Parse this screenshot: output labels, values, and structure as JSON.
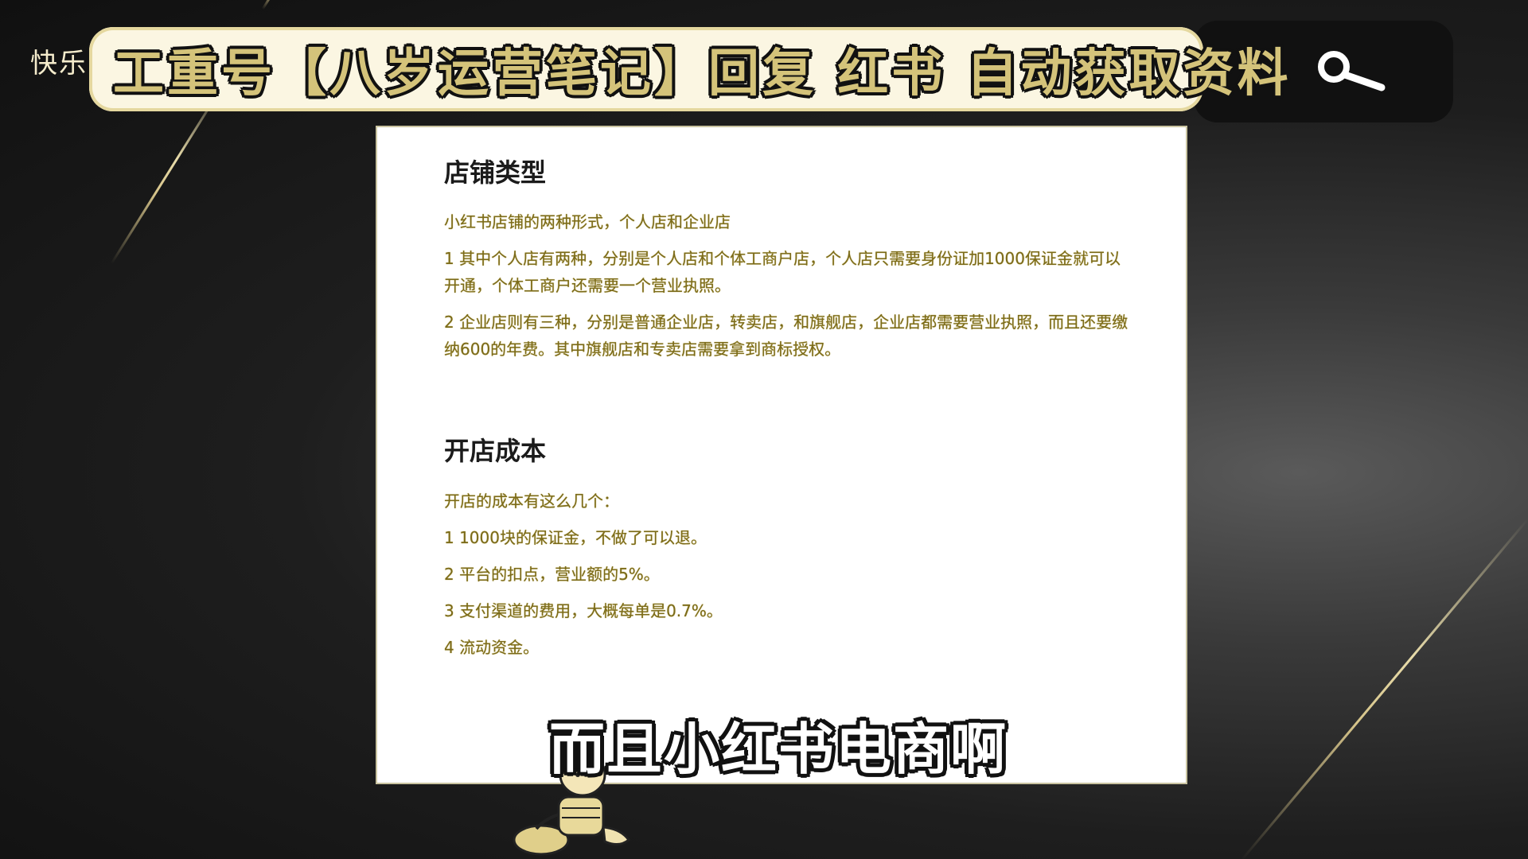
{
  "watermark": {
    "text": "快乐"
  },
  "banner": {
    "text": "工重号【八岁运营笔记】回复 红书 自动获取资料"
  },
  "document": {
    "sections": [
      {
        "title": "店铺类型",
        "paragraphs": [
          "小红书店铺的两种形式，个人店和企业店",
          "1 其中个人店有两种，分别是个人店和个体工商户店，个人店只需要身份证加1000保证金就可以开通，个体工商户还需要一个营业执照。",
          "2 企业店则有三种，分别是普通企业店，转卖店，和旗舰店，企业店都需要营业执照，而且还要缴纳600的年费。其中旗舰店和专卖店需要拿到商标授权。"
        ]
      },
      {
        "title": "开店成本",
        "paragraphs": [
          "开店的成本有这么几个：",
          "1 1000块的保证金，不做了可以退。",
          "2 平台的扣点，营业额的5%。",
          "3 支付渠道的费用，大概每单是0.7%。",
          "4 流动资金。"
        ]
      }
    ]
  },
  "subtitle": {
    "text": "而且小红书电商啊"
  },
  "colors": {
    "banner_text": "#d4c37a",
    "body_text": "#7a6a1a",
    "heading_text": "#1b1b1b"
  }
}
